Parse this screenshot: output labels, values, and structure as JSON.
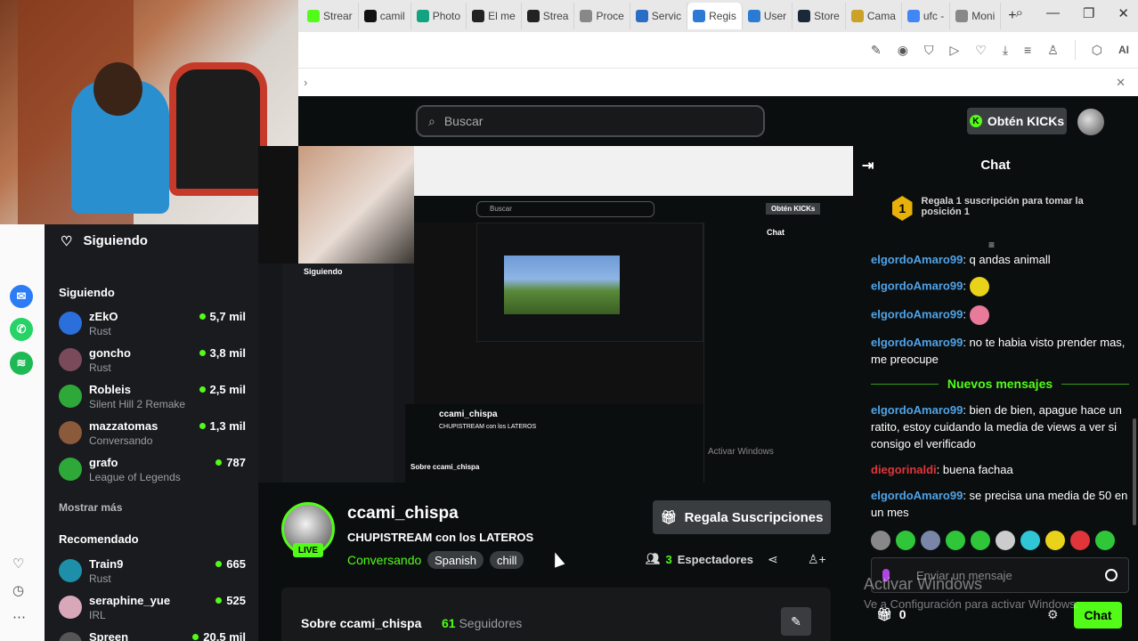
{
  "browser": {
    "tabs": [
      {
        "label": "Strear",
        "color": "#53fc18"
      },
      {
        "label": "camil",
        "color": "#111111"
      },
      {
        "label": "Photo",
        "color": "#14a37f"
      },
      {
        "label": "El me",
        "color": "#222222"
      },
      {
        "label": "Strea",
        "color": "#222222"
      },
      {
        "label": "Proce",
        "color": "#888888"
      },
      {
        "label": "Servic",
        "color": "#2b6cc4"
      },
      {
        "label": "Regis",
        "color": "#2b7bd4"
      },
      {
        "label": "User",
        "color": "#2b7bd4"
      },
      {
        "label": "Store",
        "color": "#1b2838"
      },
      {
        "label": "Cama",
        "color": "#c9a227"
      },
      {
        "label": "ufc -",
        "color": "#4285f4"
      },
      {
        "label": "Moni",
        "color": "#888888"
      }
    ],
    "toolbar_ai": "AI"
  },
  "kick": {
    "search_placeholder": "Buscar",
    "kicks_button": "Obtén KICKs",
    "kicks_letter": "K"
  },
  "sidebar": {
    "title": "Siguiendo",
    "following_section": "Siguiendo",
    "following": [
      {
        "name": "zEkO",
        "game": "Rust",
        "viewers": "5,7 mil",
        "color": "#2a6fdb"
      },
      {
        "name": "goncho",
        "game": "Rust",
        "viewers": "3,8 mil",
        "color": "#7a4a5a"
      },
      {
        "name": "Robleis",
        "game": "Silent Hill 2 Remake",
        "viewers": "2,5 mil",
        "color": "#2fa83a"
      },
      {
        "name": "mazzatomas",
        "game": "Conversando",
        "viewers": "1,3 mil",
        "color": "#8a5a3a"
      },
      {
        "name": "grafo",
        "game": "League of Legends",
        "viewers": "787",
        "color": "#2fa83a"
      }
    ],
    "show_more": "Mostrar más",
    "recommended_section": "Recomendado",
    "recommended": [
      {
        "name": "Train9",
        "game": "Rust",
        "viewers": "665",
        "color": "#1e8fa8"
      },
      {
        "name": "seraphine_yue",
        "game": "IRL",
        "viewers": "525",
        "color": "#d8a8b8"
      },
      {
        "name": "Spreen",
        "game": "",
        "viewers": "20,5 mil",
        "color": "#555555"
      }
    ]
  },
  "stream": {
    "streamer": "ccami_chispa",
    "title": "CHUPISTREAM con los LATEROS",
    "category": "Conversando",
    "tags": [
      "Spanish",
      "chill"
    ],
    "live_label": "LIVE",
    "gift_button": "Regala Suscripciones",
    "viewers_count": "3",
    "viewers_label": "Espectadores",
    "about_title": "Sobre ccami_chispa",
    "followers_count": "61",
    "followers_label": "Seguidores"
  },
  "chat": {
    "title": "Chat",
    "pinned_badge": "1",
    "pinned": "Regala 1 suscripción para tomar la posición 1",
    "messages": [
      {
        "user": "elgordoAmaro99",
        "text": ": q andas animall",
        "emote": ""
      },
      {
        "user": "elgordoAmaro99",
        "text": ":",
        "emote": "#e8d21a"
      },
      {
        "user": "elgordoAmaro99",
        "text": ":",
        "emote": "#e87a9a"
      },
      {
        "user": "elgordoAmaro99",
        "text": ": no te habia visto prender mas, me preocupe",
        "emote": ""
      }
    ],
    "new_messages": "Nuevos mensajes",
    "messages2": [
      {
        "user": "elgordoAmaro99",
        "text": ": bien de bien, apague hace un ratito, estoy cuidando la media de views a ver si consigo el verificado",
        "red": false
      },
      {
        "user": "diegorinaldi",
        "text": ": buena fachaa",
        "red": true
      },
      {
        "user": "elgordoAmaro99",
        "text": ": se precisa una media de 50 en un mes",
        "red": false
      }
    ],
    "emote_colors": [
      "#888888",
      "#2fc63a",
      "#7a86a8",
      "#2fc63a",
      "#2fc63a",
      "#cccccc",
      "#2fc6d6",
      "#e8d21a",
      "#e0353a",
      "#2fc63a"
    ],
    "input_placeholder": "Enviar un mensaje",
    "gift_count": "0",
    "chat_button": "Chat"
  },
  "windows_watermark": {
    "line1": "Activar Windows",
    "line2": "Ve a Configuración para activar Windows."
  },
  "player_preview": {
    "search": "Buscar",
    "kicks": "Obtén KICKs",
    "chat": "Chat",
    "sidebar_title": "Siguiendo",
    "streamer": "ccami_chispa",
    "title": "CHUPISTREAM con los LATEROS",
    "about": "Sobre ccami_chispa",
    "watermark": "Activar Windows"
  }
}
